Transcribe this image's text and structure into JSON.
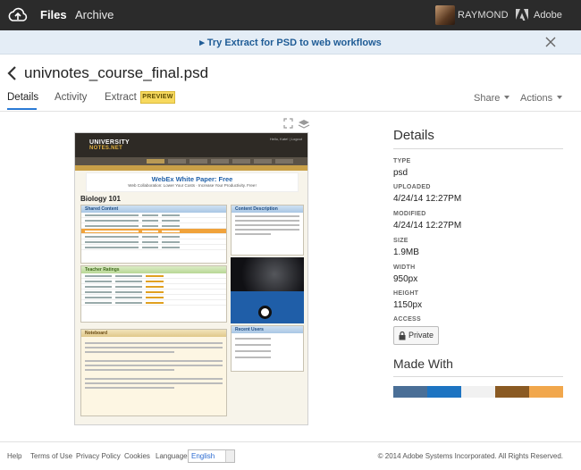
{
  "topbar": {
    "nav": {
      "files": "Files",
      "archive": "Archive"
    },
    "user": {
      "name": "RAYMOND"
    },
    "brand": "Adobe"
  },
  "banner": {
    "text": "▸ Try Extract for PSD to web workflows"
  },
  "file": {
    "name": "univnotes_course_final.psd"
  },
  "tabs": [
    {
      "label": "Details",
      "active": true
    },
    {
      "label": "Activity"
    },
    {
      "label": "Extract"
    }
  ],
  "preview_badge": "PREVIEW",
  "menus": {
    "share": "Share",
    "actions": "Actions"
  },
  "preview": {
    "site_logo_line1": "UNIVERSITY",
    "site_logo_line2": "NOTES.NET",
    "login": "Hello, Kate! | Logout",
    "ad_title": "WebEx White Paper: Free",
    "ad_sub": "Web Collaboration: Lower Your Costs · Increase Your Productivity. Free!",
    "heading": "Biology 101",
    "panels": {
      "shared": "Shared Content",
      "ratings": "Teacher Ratings",
      "noteboard": "Noteboard",
      "content_desc": "Content Description",
      "recent_users": "Recent Users"
    }
  },
  "details": {
    "title": "Details",
    "type_label": "TYPE",
    "type_value": "psd",
    "uploaded_label": "UPLOADED",
    "uploaded_value": "4/24/14 12:27PM",
    "modified_label": "MODIFIED",
    "modified_value": "4/24/14 12:27PM",
    "size_label": "SIZE",
    "size_value": "1.9MB",
    "width_label": "WIDTH",
    "width_value": "950px",
    "height_label": "HEIGHT",
    "height_value": "1150px",
    "access_label": "ACCESS",
    "access_value": "Private",
    "made_with_title": "Made With",
    "swatches": [
      "#4a6f97",
      "#1d74c2",
      "#f1f1f1",
      "#8a5a23",
      "#f1a74c"
    ]
  },
  "footer": {
    "help": "Help",
    "terms": "Terms of Use",
    "privacy": "Privacy Policy",
    "cookies": "Cookies",
    "language_label": "Language:",
    "language_value": "English",
    "copyright": "© 2014 Adobe Systems Incorporated. All Rights Reserved."
  }
}
